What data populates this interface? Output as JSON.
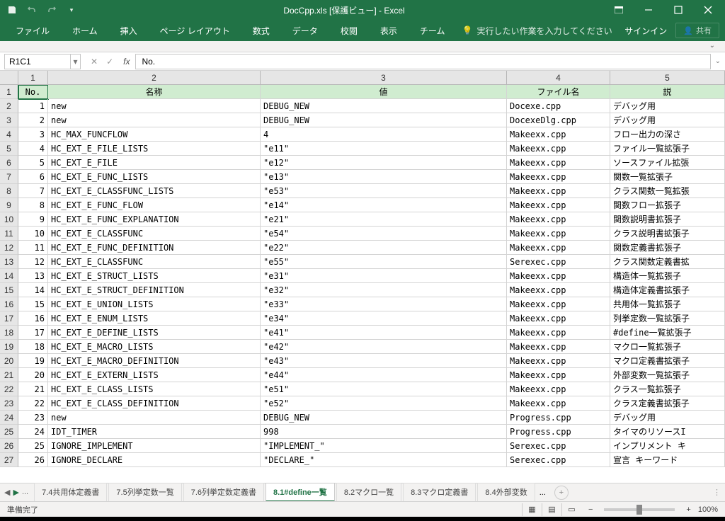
{
  "title": "DocCpp.xls  [保護ビュー] - Excel",
  "ribbon": {
    "tabs": [
      "ファイル",
      "ホーム",
      "挿入",
      "ページ レイアウト",
      "数式",
      "データ",
      "校閲",
      "表示",
      "チーム"
    ],
    "tellme": "実行したい作業を入力してください",
    "signin": "サインイン",
    "share": "共有"
  },
  "nameBox": "R1C1",
  "formula": "No.",
  "cols": [
    "1",
    "2",
    "3",
    "4",
    "5"
  ],
  "headers": [
    "No.",
    "名称",
    "値",
    "ファイル名",
    "説"
  ],
  "rows": [
    {
      "n": "1",
      "name": "new",
      "val": "DEBUG_NEW",
      "file": "Docexe.cpp",
      "desc": "デバッグ用"
    },
    {
      "n": "2",
      "name": "new",
      "val": "DEBUG_NEW",
      "file": "DocexeDlg.cpp",
      "desc": "デバッグ用"
    },
    {
      "n": "3",
      "name": "HC_MAX_FUNCFLOW",
      "val": "4",
      "file": "Makeexx.cpp",
      "desc": "フロー出力の深さ"
    },
    {
      "n": "4",
      "name": "HC_EXT_E_FILE_LISTS",
      "val": "\"e11\"",
      "file": "Makeexx.cpp",
      "desc": "ファイル一覧拡張子"
    },
    {
      "n": "5",
      "name": "HC_EXT_E_FILE",
      "val": "\"e12\"",
      "file": "Makeexx.cpp",
      "desc": "ソースファイル拡張"
    },
    {
      "n": "6",
      "name": "HC_EXT_E_FUNC_LISTS",
      "val": "\"e13\"",
      "file": "Makeexx.cpp",
      "desc": "関数一覧拡張子"
    },
    {
      "n": "7",
      "name": "HC_EXT_E_CLASSFUNC_LISTS",
      "val": "\"e53\"",
      "file": "Makeexx.cpp",
      "desc": "クラス関数一覧拡張"
    },
    {
      "n": "8",
      "name": "HC_EXT_E_FUNC_FLOW",
      "val": "\"e14\"",
      "file": "Makeexx.cpp",
      "desc": "関数フロー拡張子"
    },
    {
      "n": "9",
      "name": "HC_EXT_E_FUNC_EXPLANATION",
      "val": "\"e21\"",
      "file": "Makeexx.cpp",
      "desc": "関数説明書拡張子"
    },
    {
      "n": "10",
      "name": "HC_EXT_E_CLASSFUNC",
      "val": "\"e54\"",
      "file": "Makeexx.cpp",
      "desc": "クラス説明書拡張子"
    },
    {
      "n": "11",
      "name": "HC_EXT_E_FUNC_DEFINITION",
      "val": "\"e22\"",
      "file": "Makeexx.cpp",
      "desc": "関数定義書拡張子"
    },
    {
      "n": "12",
      "name": "HC_EXT_E_CLASSFUNC",
      "val": "\"e55\"",
      "file": "Serexec.cpp",
      "desc": "クラス関数定義書拡"
    },
    {
      "n": "13",
      "name": "HC_EXT_E_STRUCT_LISTS",
      "val": "\"e31\"",
      "file": "Makeexx.cpp",
      "desc": "構造体一覧拡張子"
    },
    {
      "n": "14",
      "name": "HC_EXT_E_STRUCT_DEFINITION",
      "val": "\"e32\"",
      "file": "Makeexx.cpp",
      "desc": "構造体定義書拡張子"
    },
    {
      "n": "15",
      "name": "HC_EXT_E_UNION_LISTS",
      "val": "\"e33\"",
      "file": "Makeexx.cpp",
      "desc": "共用体一覧拡張子"
    },
    {
      "n": "16",
      "name": "HC_EXT_E_ENUM_LISTS",
      "val": "\"e34\"",
      "file": "Makeexx.cpp",
      "desc": "列挙定数一覧拡張子"
    },
    {
      "n": "17",
      "name": "HC_EXT_E_DEFINE_LISTS",
      "val": "\"e41\"",
      "file": "Makeexx.cpp",
      "desc": "#define一覧拡張子"
    },
    {
      "n": "18",
      "name": "HC_EXT_E_MACRO_LISTS",
      "val": "\"e42\"",
      "file": "Makeexx.cpp",
      "desc": "マクロ一覧拡張子"
    },
    {
      "n": "19",
      "name": "HC_EXT_E_MACRO_DEFINITION",
      "val": "\"e43\"",
      "file": "Makeexx.cpp",
      "desc": "マクロ定義書拡張子"
    },
    {
      "n": "20",
      "name": "HC_EXT_E_EXTERN_LISTS",
      "val": "\"e44\"",
      "file": "Makeexx.cpp",
      "desc": "外部変数一覧拡張子"
    },
    {
      "n": "21",
      "name": "HC_EXT_E_CLASS_LISTS",
      "val": "\"e51\"",
      "file": "Makeexx.cpp",
      "desc": "クラス一覧拡張子"
    },
    {
      "n": "22",
      "name": "HC_EXT_E_CLASS_DEFINITION",
      "val": "\"e52\"",
      "file": "Makeexx.cpp",
      "desc": "クラス定義書拡張子"
    },
    {
      "n": "23",
      "name": "new",
      "val": "DEBUG_NEW",
      "file": "Progress.cpp",
      "desc": "デバッグ用"
    },
    {
      "n": "24",
      "name": "IDT_TIMER",
      "val": "998",
      "file": "Progress.cpp",
      "desc": "タイマのリソースI"
    },
    {
      "n": "25",
      "name": "IGNORE_IMPLEMENT",
      "val": "\"IMPLEMENT_\"",
      "file": "Serexec.cpp",
      "desc": "インプリメント キ"
    },
    {
      "n": "26",
      "name": "IGNORE_DECLARE",
      "val": "\"DECLARE_\"",
      "file": "Serexec.cpp",
      "desc": "宣言 キーワード"
    }
  ],
  "sheets": {
    "leading": "...",
    "items": [
      "7.4共用体定義書",
      "7.5列挙定数一覧",
      "7.6列挙定数定義書",
      "8.1#define一覧",
      "8.2マクロ一覧",
      "8.3マクロ定義書",
      "8.4外部変数"
    ],
    "trailing": "...",
    "active": 3
  },
  "status": {
    "ready": "準備完了",
    "zoom": "100%"
  }
}
